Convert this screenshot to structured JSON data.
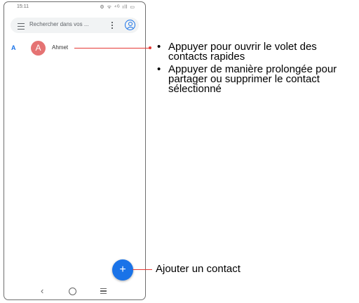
{
  "status_bar": {
    "time": "15:11",
    "icons": "⚙ ᯤ ⁴ᴳ ıll ▭"
  },
  "search": {
    "placeholder": "Rechercher dans vos ..."
  },
  "contacts": {
    "section_letter": "A",
    "items": [
      {
        "initial": "A",
        "name": "Ahmet",
        "avatar_color": "#e57373"
      }
    ]
  },
  "fab": {
    "label": "+"
  },
  "nav": {
    "back": "‹"
  },
  "callouts": {
    "contact": [
      "Appuyer pour ouvrir le volet des contacts rapides",
      "Appuyer de manière prolongée pour partager ou supprimer le contact sélectionné"
    ],
    "add": "Ajouter un contact"
  },
  "colors": {
    "accent": "#1a73e8",
    "callout": "#e53935"
  }
}
